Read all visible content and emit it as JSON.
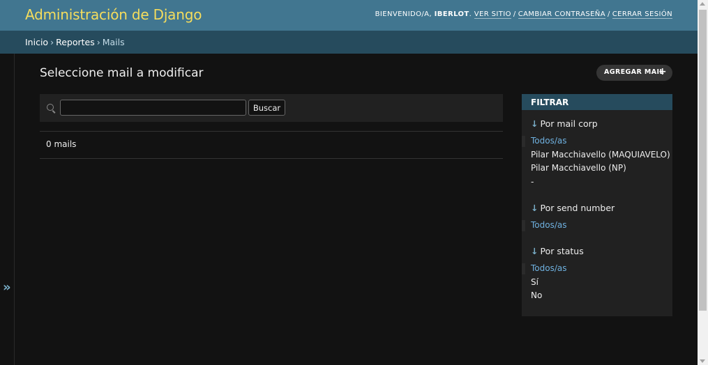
{
  "header": {
    "brand": "Administración de Django",
    "welcome": "Bienvenido/a,",
    "username": "iberlot",
    "view_site": "Ver sitio",
    "change_password": "Cambiar contraseña",
    "logout": "Cerrar sesión"
  },
  "breadcrumbs": [
    "Inicio",
    "Reportes",
    "Mails"
  ],
  "nav_toggle": "»",
  "content": {
    "title": "Seleccione mail a modificar",
    "add_button": "Agregar mail",
    "add_icon": "+",
    "search": {
      "value": "",
      "placeholder": "",
      "button": "Buscar"
    },
    "result_count": "0 mails"
  },
  "filter": {
    "title": "Filtrar",
    "groups": [
      {
        "title": "Por mail corp",
        "options": [
          "Todos/as",
          "Pilar Macchiavello (MAQUIAVELO)",
          "Pilar Macchiavello (NP)",
          "-"
        ]
      },
      {
        "title": "Por send number",
        "options": [
          "Todos/as"
        ]
      },
      {
        "title": "Por status",
        "options": [
          "Todos/as",
          "Sí",
          "No"
        ]
      }
    ]
  },
  "colors": {
    "header_bg": "#417690",
    "breadcrumbs_bg": "#264b5d",
    "brand": "#f5dd5d",
    "link": "#6fb1e0"
  }
}
